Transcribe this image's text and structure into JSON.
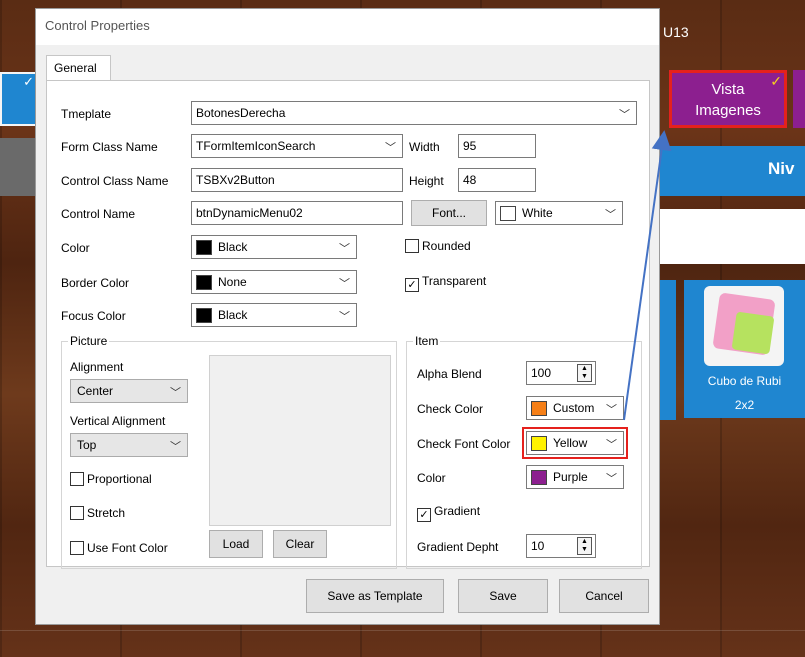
{
  "background": {
    "right_label": "U13",
    "tile_vista": {
      "line1": "Vista",
      "line2": "Imagenes",
      "check": "✓"
    },
    "tile_left_check": "✓",
    "banner_text": "Niv",
    "tile_cubo": {
      "line1": "Cubo de Rubi",
      "line2": "2x2"
    }
  },
  "dialog": {
    "title": "Control Properties",
    "close_glyph": "✕",
    "tab": "General",
    "fields": {
      "template_label": "Tmeplate",
      "template_value": "BotonesDerecha",
      "form_class_label": "Form Class Name",
      "form_class_value": "TFormItemIconSearch",
      "control_class_label": "Control Class Name",
      "control_class_value": "TSBXv2Button",
      "control_name_label": "Control Name",
      "control_name_value": "btnDynamicMenu02",
      "width_label": "Width",
      "width_value": "95",
      "height_label": "Height",
      "height_value": "48",
      "font_button": "Font...",
      "font_color_value": "White",
      "color_label": "Color",
      "color_value": "Black",
      "border_color_label": "Border Color",
      "border_color_value": "None",
      "focus_color_label": "Focus Color",
      "focus_color_value": "Black",
      "rounded_label": "Rounded",
      "rounded_checked": false,
      "transparent_label": "Transparent",
      "transparent_checked": true
    },
    "picture": {
      "group_label": "Picture",
      "alignment_label": "Alignment",
      "alignment_value": "Center",
      "valign_label": "Vertical Alignment",
      "valign_value": "Top",
      "proportional_label": "Proportional",
      "stretch_label": "Stretch",
      "use_font_color_label": "Use Font Color",
      "load_button": "Load",
      "clear_button": "Clear"
    },
    "item": {
      "group_label": "Item",
      "alpha_label": "Alpha Blend",
      "alpha_value": "100",
      "check_color_label": "Check Color",
      "check_color_value": "Custom",
      "check_font_color_label": "Check Font Color",
      "check_font_color_value": "Yellow",
      "color_label": "Color",
      "color_value": "Purple",
      "gradient_label": "Gradient",
      "gradient_checked": true,
      "gradient_depth_label": "Gradient Depht",
      "gradient_depth_value": "10"
    },
    "buttons": {
      "save_template": "Save as Template",
      "save": "Save",
      "cancel": "Cancel"
    }
  },
  "colors": {
    "black": "#000000",
    "white": "#ffffff",
    "custom_orange": "#f57f17",
    "yellow": "#fff200",
    "purple": "#8c1f8f",
    "highlight_red": "#e5211d",
    "tile_blue": "#1f86d0"
  },
  "icons": {
    "dropdown": "chevron-down-icon",
    "spinner": "spin-updown-icon",
    "check": "checkmark-icon",
    "close": "close-icon"
  }
}
